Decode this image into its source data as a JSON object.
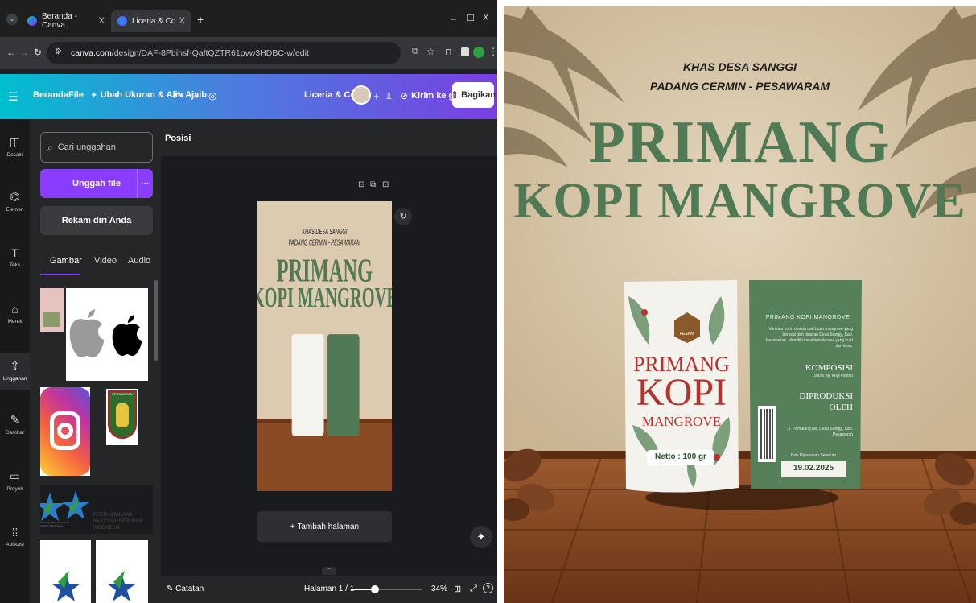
{
  "browser": {
    "tabs": [
      {
        "title": "Beranda - Canva",
        "close": "X"
      },
      {
        "title": "Liceria & Co. - Konten Instagra",
        "close": "X"
      }
    ],
    "new_tab": "+",
    "window_controls": {
      "minimize": "–",
      "maximize": "☐",
      "close": "X"
    },
    "url_host": "canva.com",
    "url_path": "/design/DAF-8Pbihsf-QaftQZTR61pvw3HDBC-w/edit"
  },
  "canva": {
    "menu_icon": "menu-icon",
    "nav": {
      "home": "Beranda",
      "file": "File",
      "resize": "Ubah Ukuran & Alih Ajaib"
    },
    "team_name": "Liceria & Co.",
    "add": "+",
    "send_label": "Kirim ke guru",
    "share_label": "Bagikan",
    "rail": [
      {
        "label": "Desain",
        "icon": "design-icon"
      },
      {
        "label": "Elemen",
        "icon": "elements-icon"
      },
      {
        "label": "Teks",
        "icon": "text-icon"
      },
      {
        "label": "Merek",
        "icon": "brand-icon"
      },
      {
        "label": "Unggahan",
        "icon": "upload-icon"
      },
      {
        "label": "Gambar",
        "icon": "draw-icon"
      },
      {
        "label": "Proyek",
        "icon": "folder-icon"
      },
      {
        "label": "Aplikasi",
        "icon": "apps-icon"
      }
    ],
    "panel": {
      "search_placeholder": "Cari unggahan",
      "upload_label": "Unggah file",
      "upload_more": "···",
      "record_label": "Rekam diri Anda",
      "tabs": [
        "Gambar",
        "Video",
        "Audio"
      ],
      "pesawaran_label": "PESAWARAN",
      "perpus_label": "PERPUSTAKAAN NASIONAL REPUBLIK INDONESIA",
      "perpus_small": "PERPUSTAKAAN NASIONAL REPUBLIK INDONESIA"
    },
    "position_label": "Posisi",
    "add_page": "+ Tambah halaman",
    "notes_label": "Catatan",
    "page_counter": "Halaman 1 / 1",
    "zoom": "34%",
    "zoom_fraction": 0.34
  },
  "poster": {
    "line1": "KHAS DESA SANGGI",
    "line2": "PADANG CERMIN - PESAWARAM",
    "title1": "PRIMANG",
    "title2": "KOPI MANGROVE",
    "pack_front": {
      "brand": "PESANI",
      "name1": "PRIMANG",
      "name2": "KOPI",
      "name3": "MANGROVE",
      "netto": "Netto : 100 gr"
    },
    "pack_back": {
      "heading": "PRIMANG KOPI MANGROVE",
      "desc": "Varietas kopi robusta dari buah mangrove yang berasal dari dataran Desa Sanggi, Kab. Pesawaran. Memiliki karakteristik rasa yang kuat dan khas.",
      "komposisi": "KOMPOSISI",
      "komposisi_val": "100% Biji Kopi Pilihan",
      "diproduksi1": "DIPRODUKSI",
      "diproduksi2": "OLEH",
      "address": "Jl. Pematang Aw, Desa Sanggi, Kab. Pesawaran",
      "best_before": "Baik Digunakan Sebelum",
      "date": "19.02.2025"
    },
    "colors": {
      "green": "#4f7a55",
      "bg": "#d9c8ad",
      "wood": "#8c4b25"
    }
  }
}
